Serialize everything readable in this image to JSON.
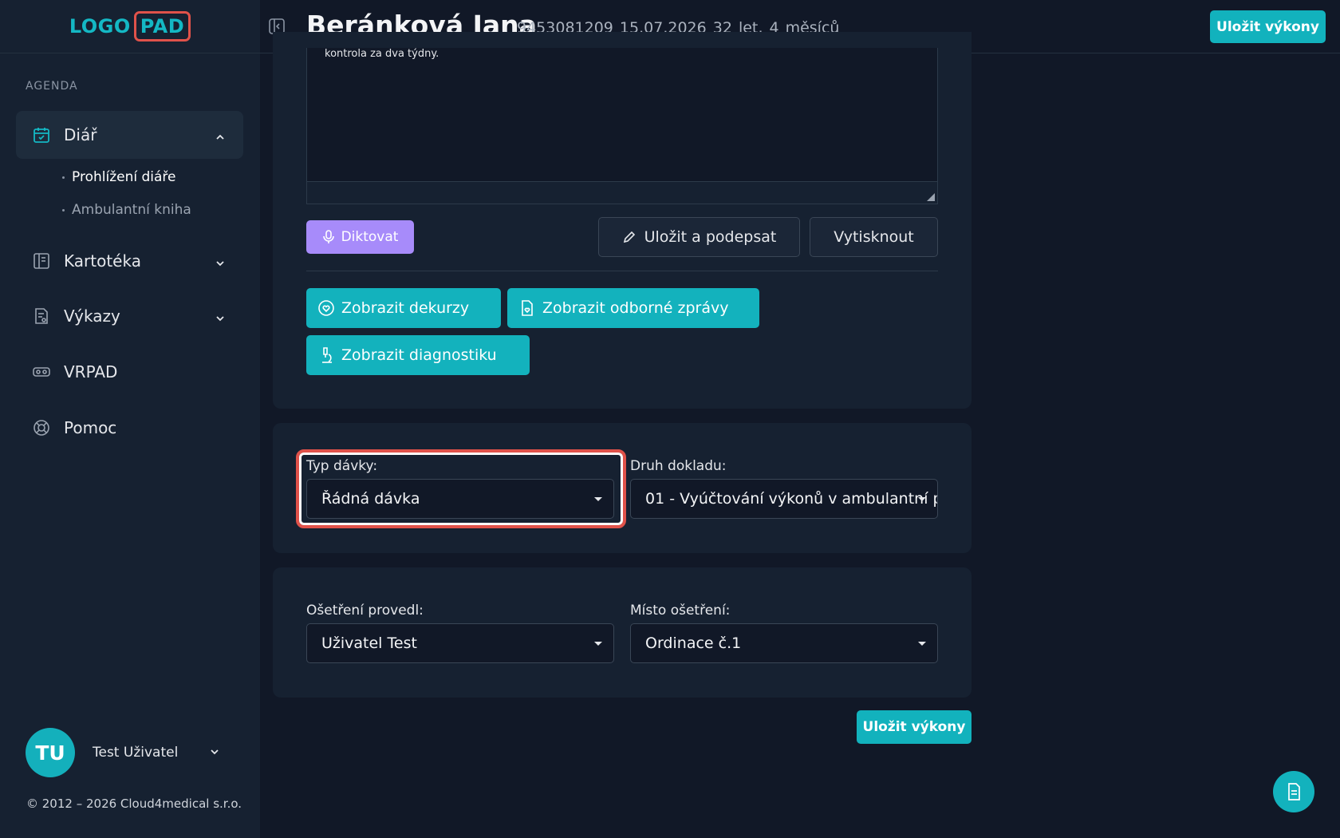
{
  "logo": {
    "part1": "LOGO",
    "part2": "PAD"
  },
  "sidebar": {
    "section_label": "AGENDA",
    "items": [
      {
        "label": "Diář",
        "icon": "calendar-check-icon",
        "expanded": true
      },
      {
        "label": "Kartotéka",
        "icon": "book-icon"
      },
      {
        "label": "Výkazy",
        "icon": "report-icon"
      },
      {
        "label": "VRPAD",
        "icon": "vr-headset-icon"
      },
      {
        "label": "Pomoc",
        "icon": "lifebuoy-icon"
      }
    ],
    "sub_items": [
      {
        "label": "Prohlížení diáře",
        "current": true
      },
      {
        "label": "Ambulantní kniha",
        "current": false
      }
    ]
  },
  "user": {
    "initials": "TU",
    "name": "Test Uživatel"
  },
  "footer": {
    "copyright": "© 2012 – 2026 Cloud4medical s.r.o."
  },
  "header": {
    "patient_name": "Beránková Jana",
    "patient_meta": "9453081209 15.07.2026 32 let, 4 měsíců",
    "save_label": "Uložit výkony"
  },
  "note": {
    "text": "kontrola za dva týdny."
  },
  "actions": {
    "dictate": "Diktovat",
    "save_sign": "Uložit a podepsat",
    "print": "Vytisknout",
    "show_decourse": "Zobrazit dekurzy",
    "show_reports": "Zobrazit odborné zprávy",
    "show_diagnostics": "Zobrazit diagnostiku"
  },
  "batch": {
    "type_label": "Typ dávky:",
    "type_value": "Řádná dávka",
    "doc_label": "Druh dokladu:",
    "doc_value": "01 - Vyúčtování výkonů v ambulantní p"
  },
  "treatment": {
    "performer_label": "Ošetření provedl:",
    "performer_value": "Uživatel Test",
    "place_label": "Místo ošetření:",
    "place_value": "Ordinace č.1"
  },
  "bottom": {
    "save_label": "Uložit výkony"
  },
  "colors": {
    "accent": "#13b2bd",
    "dictate": "#a78bfa",
    "highlight": "#e0524a"
  }
}
